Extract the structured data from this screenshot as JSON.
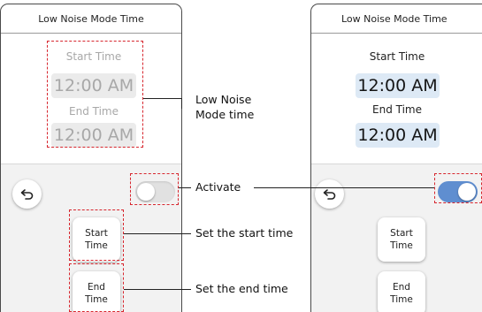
{
  "left_panel": {
    "header": "Low Noise Mode Time",
    "start_label": "Start Time",
    "start_value": "12:00 AM",
    "end_label": "End Time",
    "end_value": "12:00 AM",
    "toggle_state": "off",
    "start_button": "Start\nTime",
    "end_button": "End\nTime"
  },
  "right_panel": {
    "header": "Low Noise Mode Time",
    "start_label": "Start Time",
    "start_value": "12:00 AM",
    "end_label": "End Time",
    "end_value": "12:00 AM",
    "toggle_state": "on",
    "start_button": "Start\nTime",
    "end_button": "End\nTime"
  },
  "callouts": {
    "low_noise_time": "Low Noise\nMode time",
    "activate": "Activate",
    "set_start": "Set the start time",
    "set_end": "Set the end time"
  },
  "colors": {
    "highlight_dash": "#d7262e",
    "toggle_on": "#5f8ed0",
    "time_on_bg": "#dde9f5"
  }
}
